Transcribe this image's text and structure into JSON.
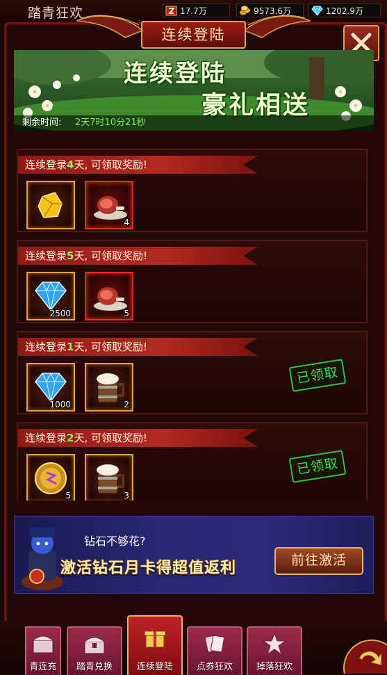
{
  "topbar": {
    "event_title": "踏青狂欢",
    "resources": {
      "energy": "17.7万",
      "gold": "9573.6万",
      "gems": "1202.9万"
    }
  },
  "panel": {
    "title": "连续登陆"
  },
  "banner": {
    "line1": "连续登陆",
    "line2": "豪礼相送",
    "timer_label": "剩余时间:",
    "timer_value": "2天7时10分21秒"
  },
  "rewards": [
    {
      "prefix": "连续登录",
      "days": "4",
      "suffix": "天, 可领取奖励!",
      "items": [
        {
          "icon": "gold-crystal-icon",
          "count": ""
        },
        {
          "icon": "roast-meat-icon",
          "count": "4"
        }
      ],
      "claimed": ""
    },
    {
      "prefix": "连续登录",
      "days": "5",
      "suffix": "天, 可领取奖励!",
      "items": [
        {
          "icon": "diamond-icon",
          "count": "2500"
        },
        {
          "icon": "roast-meat-icon",
          "count": "5"
        }
      ],
      "claimed": ""
    },
    {
      "prefix": "连续登录",
      "days": "1",
      "suffix": "天, 可领取奖励!",
      "items": [
        {
          "icon": "diamond-icon",
          "count": "1000"
        },
        {
          "icon": "beer-mug-icon",
          "count": "2"
        }
      ],
      "claimed": "已领取"
    },
    {
      "prefix": "连续登录",
      "days": "2",
      "suffix": "天, 可领取奖励!",
      "items": [
        {
          "icon": "gold-orb-icon",
          "count": "5"
        },
        {
          "icon": "beer-mug-icon",
          "count": "3"
        }
      ],
      "claimed": "已领取"
    }
  ],
  "promo": {
    "question": "钻石不够花?",
    "headline": "激活钻石月卡得超值返利",
    "button": "前往激活"
  },
  "tabs": [
    {
      "label": "青连充",
      "icon": "chest-icon"
    },
    {
      "label": "踏青兑换",
      "icon": "treasure-chest-icon"
    },
    {
      "label": "连续登陆",
      "icon": "gift-icon"
    },
    {
      "label": "点券狂欢",
      "icon": "cards-icon"
    },
    {
      "label": "掉落狂欢",
      "icon": "star-icon"
    }
  ],
  "colors": {
    "accent_green": "#7cf05a",
    "ribbon_red": "#b22a1f",
    "gold_border": "#d8aa57",
    "claimed_green": "#36e050"
  }
}
